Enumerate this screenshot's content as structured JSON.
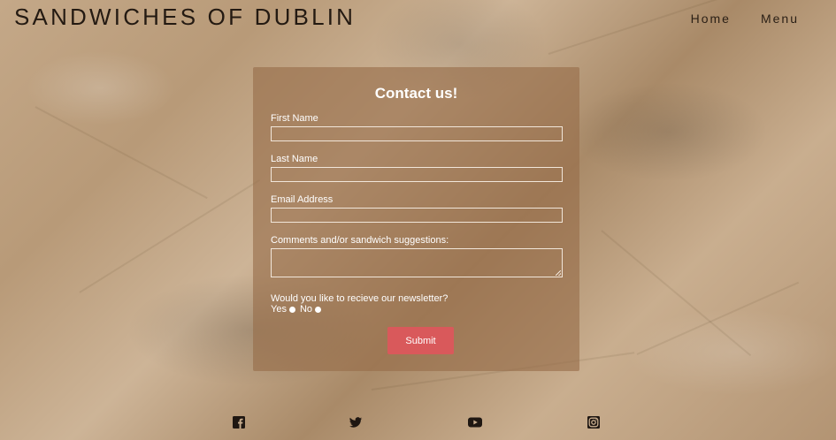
{
  "header": {
    "site_title": "SANDWICHES OF DUBLIN",
    "nav": [
      {
        "label": "Home"
      },
      {
        "label": "Menu"
      }
    ]
  },
  "form": {
    "title": "Contact us!",
    "fields": {
      "first_name": {
        "label": "First Name",
        "value": ""
      },
      "last_name": {
        "label": "Last Name",
        "value": ""
      },
      "email": {
        "label": "Email Address",
        "value": ""
      },
      "comments": {
        "label": "Comments and/or sandwich suggestions:",
        "value": ""
      }
    },
    "newsletter": {
      "question": "Would you like to recieve our newsletter?",
      "options": [
        "Yes",
        "No"
      ]
    },
    "submit_label": "Submit"
  },
  "footer": {
    "social_icons": [
      "facebook-icon",
      "twitter-icon",
      "youtube-icon",
      "instagram-icon"
    ]
  },
  "colors": {
    "title_text": "#241a12",
    "card_bg": "rgba(150,108,72,0.62)",
    "submit_bg": "#d9595b"
  }
}
